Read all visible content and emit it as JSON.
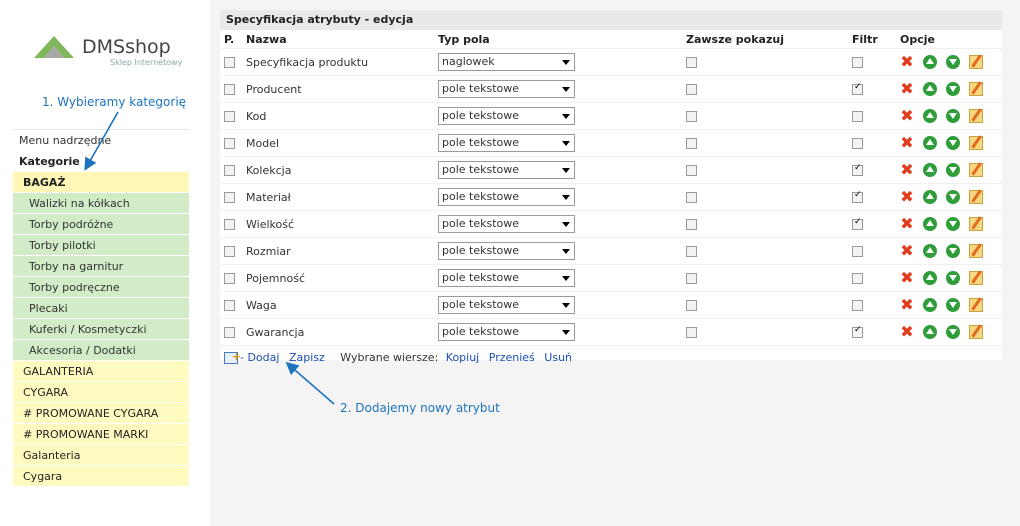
{
  "logo": {
    "name": "DMSshop",
    "tagline": "Sklep Internetowy"
  },
  "annotations": {
    "step1": "1. Wybieramy kategorię",
    "step2": "2. Dodajemy nowy atrybut"
  },
  "menu": {
    "top": "Menu nadrzędne",
    "heading": "Kategorie",
    "selected": "BAGAŻ",
    "sub": [
      "Walizki na kółkach",
      "Torby podróżne",
      "Torby pilotki",
      "Torby na garnitur",
      "Torby podręczne",
      "Plecaki",
      "Kuferki / Kosmetyczki",
      "Akcesoria / Dodatki"
    ],
    "other": [
      "GALANTERIA",
      "CYGARA",
      "# PROMOWANE CYGARA",
      "# PROMOWANE MARKI",
      "Galanteria",
      "Cygara"
    ]
  },
  "panel": {
    "title": "Specyfikacja atrybuty - edycja",
    "headers": {
      "p": "P.",
      "name": "Nazwa",
      "type": "Typ pola",
      "always": "Zawsze pokazuj",
      "filter": "Filtr",
      "options": "Opcje"
    },
    "rows": [
      {
        "name": "Specyfikacja produktu",
        "type": "naglowek",
        "always": false,
        "filter": false
      },
      {
        "name": "Producent",
        "type": "pole tekstowe",
        "always": false,
        "filter": true
      },
      {
        "name": "Kod",
        "type": "pole tekstowe",
        "always": false,
        "filter": false
      },
      {
        "name": "Model",
        "type": "pole tekstowe",
        "always": false,
        "filter": false
      },
      {
        "name": "Kolekcja",
        "type": "pole tekstowe",
        "always": false,
        "filter": true
      },
      {
        "name": "Materiał",
        "type": "pole tekstowe",
        "always": false,
        "filter": true
      },
      {
        "name": "Wielkość",
        "type": "pole tekstowe",
        "always": false,
        "filter": true
      },
      {
        "name": "Rozmiar",
        "type": "pole tekstowe",
        "always": false,
        "filter": false
      },
      {
        "name": "Pojemność",
        "type": "pole tekstowe",
        "always": false,
        "filter": false
      },
      {
        "name": "Waga",
        "type": "pole tekstowe",
        "always": false,
        "filter": false
      },
      {
        "name": "Gwarancja",
        "type": "pole tekstowe",
        "always": false,
        "filter": true
      }
    ],
    "footer": {
      "add": "- Dodaj",
      "save": "Zapisz",
      "selected_label": "Wybrane wiersze:",
      "copy": "Kopiuj",
      "move": "Przenieś",
      "delete": "Usuń"
    }
  },
  "icons": {
    "delete": "delete-x-icon",
    "up": "move-up-icon",
    "down": "move-down-icon",
    "edit": "edit-pencil-icon",
    "add": "add-item-icon"
  },
  "colors": {
    "link": "#1a4fb8",
    "annotation": "#1e73be",
    "sub_bg": "#d2ecc8",
    "cat_bg": "#fffbc0"
  }
}
